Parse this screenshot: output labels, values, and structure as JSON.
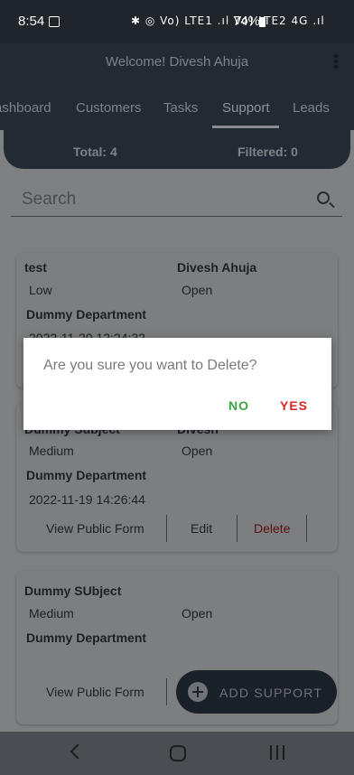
{
  "status_bar": {
    "time": "8:54",
    "network_text": "✱ ◎ Vo) LTE1 .ıl Vo) LTE2 4G .ıl",
    "battery": "74%"
  },
  "app_bar": {
    "title": "Welcome! Divesh Ahuja"
  },
  "tabs": [
    "ashboard",
    "Customers",
    "Tasks",
    "Support",
    "Leads"
  ],
  "active_tab": "Support",
  "summary": {
    "total": "Total: 4",
    "filtered": "Filtered: 0"
  },
  "search": {
    "placeholder": "Search"
  },
  "cards": [
    {
      "subject": "test",
      "assignee": "Divesh Ahuja",
      "priority": "Low",
      "status": "Open",
      "department": "Dummy Department",
      "date": "2022-11-20 12:24:32"
    },
    {
      "subject": "Dummy Subject",
      "assignee": "Divesh",
      "priority": "Medium",
      "status": "Open",
      "department": "Dummy Department",
      "date": "2022-11-19 14:26:44",
      "actions": {
        "view": "View Public Form",
        "edit": "Edit",
        "delete": "Delete"
      }
    },
    {
      "subject": "Dummy SUbject",
      "priority": "Medium",
      "status": "Open",
      "department": "Dummy Department",
      "actions": {
        "view": "View Public Form"
      }
    }
  ],
  "dialog": {
    "message": "Are you sure you want to Delete?",
    "no": "NO",
    "yes": "YES"
  },
  "fab": {
    "label": "ADD SUPPORT"
  },
  "colors": {
    "no_button": "#3ba545",
    "yes_button": "#d32626",
    "header": "#222b34"
  }
}
